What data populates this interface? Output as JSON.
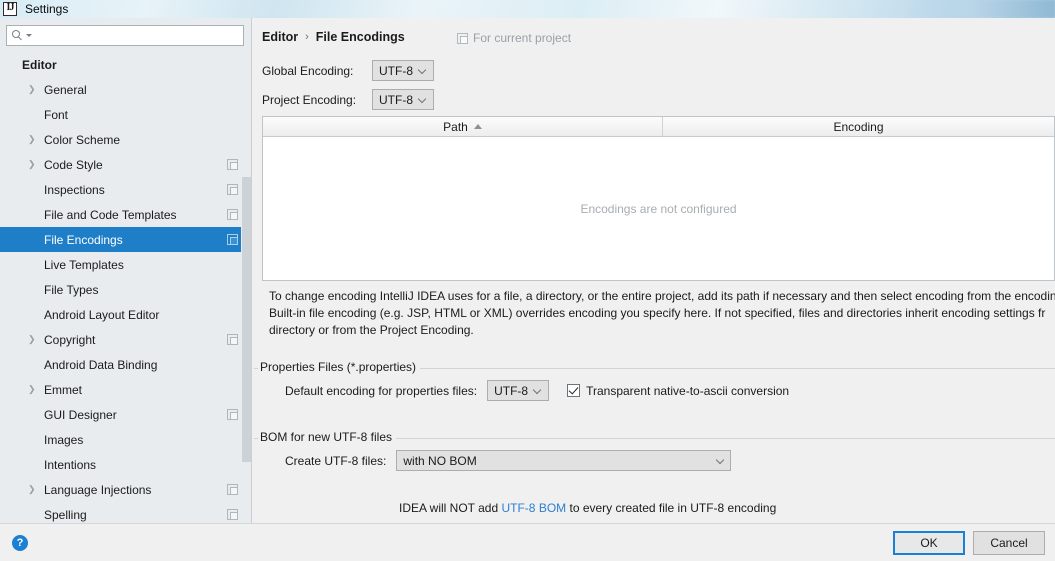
{
  "window": {
    "title": "Settings",
    "app_icon": "intellij-idea-icon"
  },
  "sidebar": {
    "search": {
      "value": "",
      "placeholder": ""
    },
    "items": [
      {
        "label": "Editor",
        "level": 0,
        "chevron": false,
        "copy": false,
        "selected": false
      },
      {
        "label": "General",
        "level": 1,
        "chevron": true,
        "copy": false,
        "selected": false
      },
      {
        "label": "Font",
        "level": 1,
        "chevron": false,
        "copy": false,
        "selected": false
      },
      {
        "label": "Color Scheme",
        "level": 1,
        "chevron": true,
        "copy": false,
        "selected": false
      },
      {
        "label": "Code Style",
        "level": 1,
        "chevron": true,
        "copy": true,
        "selected": false
      },
      {
        "label": "Inspections",
        "level": 1,
        "chevron": false,
        "copy": true,
        "selected": false
      },
      {
        "label": "File and Code Templates",
        "level": 1,
        "chevron": false,
        "copy": true,
        "selected": false
      },
      {
        "label": "File Encodings",
        "level": 1,
        "chevron": false,
        "copy": true,
        "selected": true
      },
      {
        "label": "Live Templates",
        "level": 1,
        "chevron": false,
        "copy": false,
        "selected": false
      },
      {
        "label": "File Types",
        "level": 1,
        "chevron": false,
        "copy": false,
        "selected": false
      },
      {
        "label": "Android Layout Editor",
        "level": 1,
        "chevron": false,
        "copy": false,
        "selected": false
      },
      {
        "label": "Copyright",
        "level": 1,
        "chevron": true,
        "copy": true,
        "selected": false
      },
      {
        "label": "Android Data Binding",
        "level": 1,
        "chevron": false,
        "copy": false,
        "selected": false
      },
      {
        "label": "Emmet",
        "level": 1,
        "chevron": true,
        "copy": false,
        "selected": false
      },
      {
        "label": "GUI Designer",
        "level": 1,
        "chevron": false,
        "copy": true,
        "selected": false
      },
      {
        "label": "Images",
        "level": 1,
        "chevron": false,
        "copy": false,
        "selected": false
      },
      {
        "label": "Intentions",
        "level": 1,
        "chevron": false,
        "copy": false,
        "selected": false
      },
      {
        "label": "Language Injections",
        "level": 1,
        "chevron": true,
        "copy": true,
        "selected": false
      },
      {
        "label": "Spelling",
        "level": 1,
        "chevron": false,
        "copy": true,
        "selected": false
      }
    ]
  },
  "content": {
    "breadcrumb": {
      "parent": "Editor",
      "separator": "›",
      "current": "File Encodings"
    },
    "for_current_project": "For current project",
    "global_encoding": {
      "label": "Global Encoding:",
      "value": "UTF-8"
    },
    "project_encoding": {
      "label": "Project Encoding:",
      "value": "UTF-8"
    },
    "table": {
      "columns": [
        "Path",
        "Encoding"
      ],
      "sort_column": "Path",
      "sort_direction": "asc",
      "rows": [],
      "empty_message": "Encodings are not configured"
    },
    "help_text": {
      "line1": "To change encoding IntelliJ IDEA uses for a file, a directory, or the entire project, add its path if necessary and then select encoding from the encodin",
      "line2": "Built-in file encoding (e.g. JSP, HTML or XML) overrides encoding you specify here. If not specified, files and directories inherit encoding settings fr",
      "line3": "directory or from the Project Encoding."
    },
    "properties_group": {
      "title": "Properties Files (*.properties)",
      "default_encoding_label": "Default encoding for properties files:",
      "default_encoding_value": "UTF-8",
      "transparent_label": "Transparent native-to-ascii conversion",
      "transparent_checked": true
    },
    "bom_group": {
      "title": "BOM for new UTF-8 files",
      "create_label": "Create UTF-8 files:",
      "create_value": "with NO BOM",
      "note_prefix": "IDEA will NOT add ",
      "note_link": "UTF-8 BOM",
      "note_suffix": " to every created file in UTF-8 encoding"
    }
  },
  "footer": {
    "help": "?",
    "ok": "OK",
    "cancel": "Cancel"
  },
  "colors": {
    "selection_blue": "#1e7fc8",
    "link_blue": "#2d7fd0",
    "focus_blue": "#1b7fd4",
    "panel_bg": "#f0f0f0",
    "sidebar_bg": "#e8ecef"
  }
}
